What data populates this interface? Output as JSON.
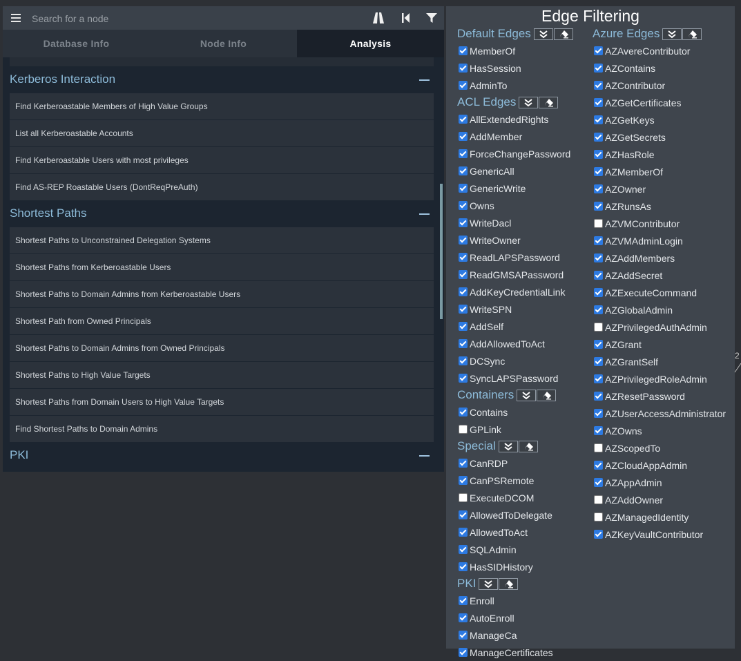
{
  "search": {
    "placeholder": "Search for a node"
  },
  "tabs": [
    {
      "label": "Database Info",
      "active": false
    },
    {
      "label": "Node Info",
      "active": false
    },
    {
      "label": "Analysis",
      "active": true
    }
  ],
  "sections": [
    {
      "title": "Kerberos Interaction",
      "queries": [
        "Find Kerberoastable Members of High Value Groups",
        "List all Kerberoastable Accounts",
        "Find Kerberoastable Users with most privileges",
        "Find AS-REP Roastable Users (DontReqPreAuth)"
      ]
    },
    {
      "title": "Shortest Paths",
      "queries": [
        "Shortest Paths to Unconstrained Delegation Systems",
        "Shortest Paths from Kerberoastable Users",
        "Shortest Paths to Domain Admins from Kerberoastable Users",
        "Shortest Path from Owned Principals",
        "Shortest Paths to Domain Admins from Owned Principals",
        "Shortest Paths to High Value Targets",
        "Shortest Paths from Domain Users to High Value Targets",
        "Find Shortest Paths to Domain Admins"
      ]
    },
    {
      "title": "PKI",
      "queries": []
    }
  ],
  "edge_filter": {
    "title": "Edge Filtering",
    "groups": {
      "default": {
        "name": "Default Edges",
        "edges": [
          {
            "label": "MemberOf",
            "checked": true
          },
          {
            "label": "HasSession",
            "checked": true
          },
          {
            "label": "AdminTo",
            "checked": true
          }
        ]
      },
      "acl": {
        "name": "ACL Edges",
        "edges": [
          {
            "label": "AllExtendedRights",
            "checked": true
          },
          {
            "label": "AddMember",
            "checked": true
          },
          {
            "label": "ForceChangePassword",
            "checked": true
          },
          {
            "label": "GenericAll",
            "checked": true
          },
          {
            "label": "GenericWrite",
            "checked": true
          },
          {
            "label": "Owns",
            "checked": true
          },
          {
            "label": "WriteDacl",
            "checked": true
          },
          {
            "label": "WriteOwner",
            "checked": true
          },
          {
            "label": "ReadLAPSPassword",
            "checked": true
          },
          {
            "label": "ReadGMSAPassword",
            "checked": true
          },
          {
            "label": "AddKeyCredentialLink",
            "checked": true
          },
          {
            "label": "WriteSPN",
            "checked": true
          },
          {
            "label": "AddSelf",
            "checked": true
          },
          {
            "label": "AddAllowedToAct",
            "checked": true
          },
          {
            "label": "DCSync",
            "checked": true
          },
          {
            "label": "SyncLAPSPassword",
            "checked": true
          }
        ]
      },
      "containers": {
        "name": "Containers",
        "edges": [
          {
            "label": "Contains",
            "checked": true
          },
          {
            "label": "GPLink",
            "checked": false
          }
        ]
      },
      "special": {
        "name": "Special",
        "edges": [
          {
            "label": "CanRDP",
            "checked": true
          },
          {
            "label": "CanPSRemote",
            "checked": true
          },
          {
            "label": "ExecuteDCOM",
            "checked": false
          },
          {
            "label": "AllowedToDelegate",
            "checked": true
          },
          {
            "label": "AllowedToAct",
            "checked": true
          },
          {
            "label": "SQLAdmin",
            "checked": true
          },
          {
            "label": "HasSIDHistory",
            "checked": true
          }
        ]
      },
      "pki": {
        "name": "PKI",
        "edges": [
          {
            "label": "Enroll",
            "checked": true
          },
          {
            "label": "AutoEnroll",
            "checked": true
          },
          {
            "label": "ManageCa",
            "checked": true
          },
          {
            "label": "ManageCertificates",
            "checked": true
          }
        ]
      },
      "azure": {
        "name": "Azure Edges",
        "edges": [
          {
            "label": "AZAvereContributor",
            "checked": true
          },
          {
            "label": "AZContains",
            "checked": true
          },
          {
            "label": "AZContributor",
            "checked": true
          },
          {
            "label": "AZGetCertificates",
            "checked": true
          },
          {
            "label": "AZGetKeys",
            "checked": true
          },
          {
            "label": "AZGetSecrets",
            "checked": true
          },
          {
            "label": "AZHasRole",
            "checked": true
          },
          {
            "label": "AZMemberOf",
            "checked": true
          },
          {
            "label": "AZOwner",
            "checked": true
          },
          {
            "label": "AZRunsAs",
            "checked": true
          },
          {
            "label": "AZVMContributor",
            "checked": false
          },
          {
            "label": "AZVMAdminLogin",
            "checked": true
          },
          {
            "label": "AZAddMembers",
            "checked": true
          },
          {
            "label": "AZAddSecret",
            "checked": true
          },
          {
            "label": "AZExecuteCommand",
            "checked": true
          },
          {
            "label": "AZGlobalAdmin",
            "checked": true
          },
          {
            "label": "AZPrivilegedAuthAdmin",
            "checked": false
          },
          {
            "label": "AZGrant",
            "checked": true
          },
          {
            "label": "AZGrantSelf",
            "checked": true
          },
          {
            "label": "AZPrivilegedRoleAdmin",
            "checked": true
          },
          {
            "label": "AZResetPassword",
            "checked": true
          },
          {
            "label": "AZUserAccessAdministrator",
            "checked": true
          },
          {
            "label": "AZOwns",
            "checked": true
          },
          {
            "label": "AZScopedTo",
            "checked": false
          },
          {
            "label": "AZCloudAppAdmin",
            "checked": true
          },
          {
            "label": "AZAppAdmin",
            "checked": true
          },
          {
            "label": "AZAddOwner",
            "checked": false
          },
          {
            "label": "AZManagedIdentity",
            "checked": false
          },
          {
            "label": "AZKeyVaultContributor",
            "checked": true
          }
        ]
      }
    }
  },
  "graph_fragment": {
    "text": "2"
  },
  "colors": {
    "accent_blue": "#8dbbd9",
    "checkbox_blue": "#2d7ae2",
    "panel_dark": "#1c2530",
    "edge_panel": "#3f454d",
    "background": "#2d3035"
  }
}
